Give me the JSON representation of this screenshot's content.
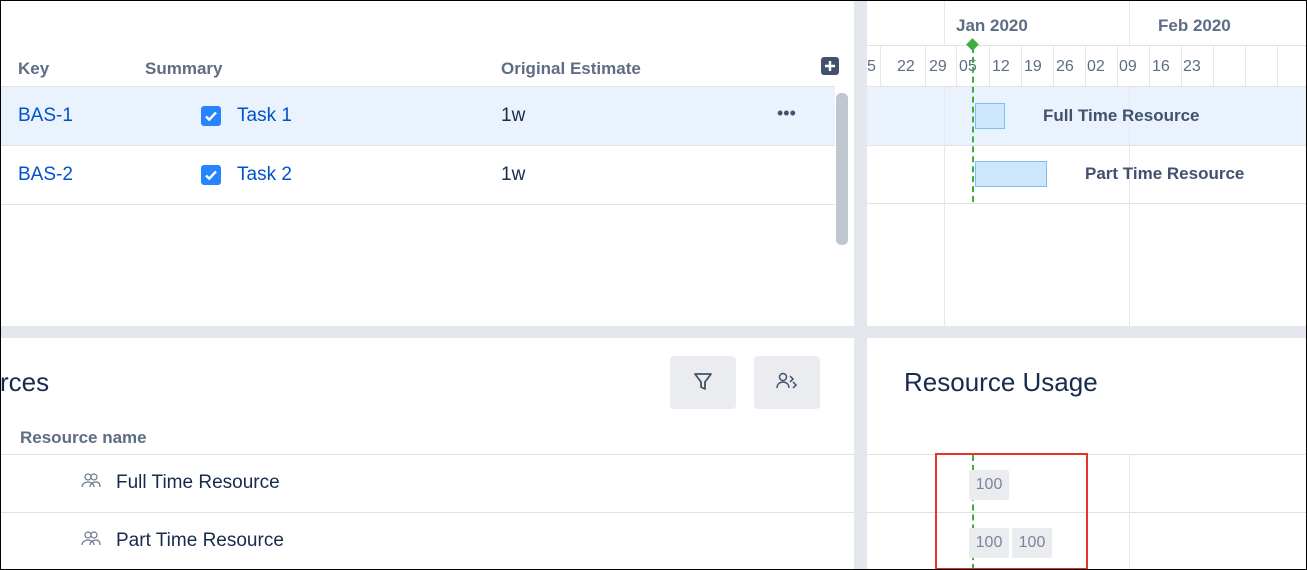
{
  "issues": {
    "columns": {
      "key": "Key",
      "summary": "Summary",
      "estimate": "Original Estimate"
    },
    "rows": [
      {
        "key": "BAS-1",
        "summary": "Task 1",
        "estimate": "1w",
        "menu": "•••"
      },
      {
        "key": "BAS-2",
        "summary": "Task 2",
        "estimate": "1w"
      }
    ]
  },
  "timeline": {
    "months": [
      "Jan 2020",
      "Feb 2020"
    ],
    "days": [
      "5",
      "22",
      "29",
      "05",
      "12",
      "19",
      "26",
      "02",
      "09",
      "16",
      "23"
    ],
    "bars": [
      {
        "label": "Full Time Resource"
      },
      {
        "label": "Part Time Resource"
      }
    ]
  },
  "resources": {
    "title": "rces",
    "column": "Resource name",
    "items": [
      {
        "name": "Full Time Resource"
      },
      {
        "name": "Part Time Resource"
      }
    ]
  },
  "usage": {
    "title": "Resource Usage",
    "rows": [
      {
        "cells": [
          "100"
        ]
      },
      {
        "cells": [
          "100",
          "100"
        ]
      }
    ]
  },
  "colors": {
    "link": "#0052cc",
    "selected_row": "#e9f2fd",
    "bar_fill": "#cce6fb",
    "today_line": "#3fae3f",
    "highlight": "#e5352b"
  }
}
